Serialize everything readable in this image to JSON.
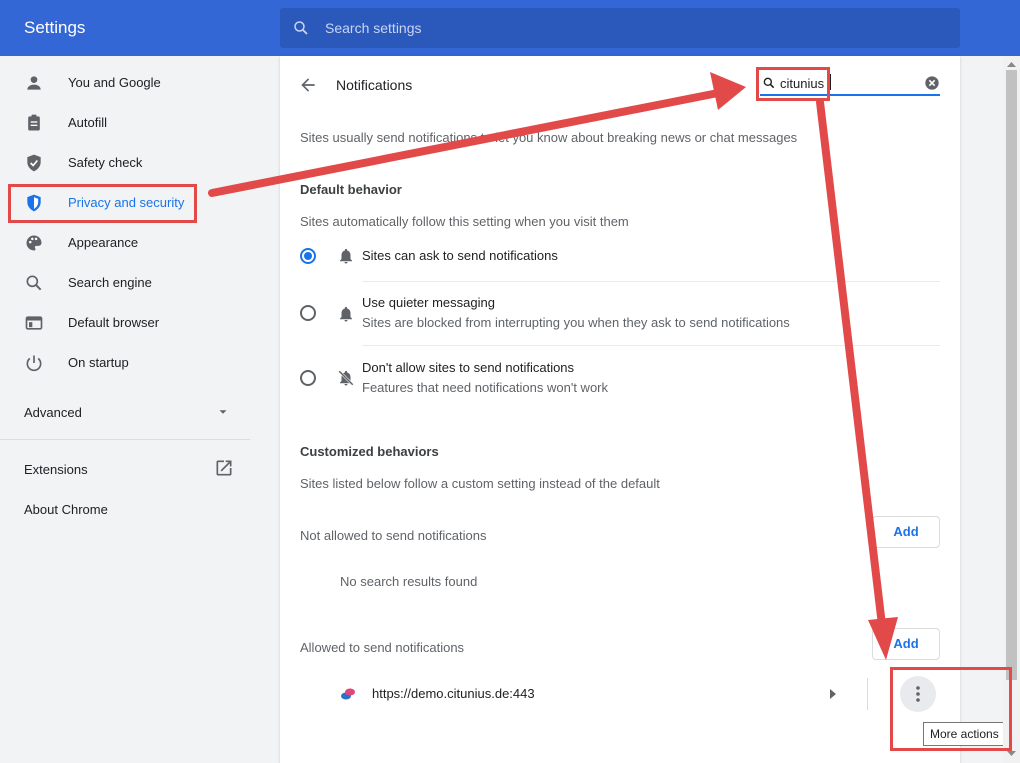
{
  "app_title": "Settings",
  "search": {
    "placeholder": "Search settings"
  },
  "sidebar": {
    "items": [
      {
        "label": "You and Google"
      },
      {
        "label": "Autofill"
      },
      {
        "label": "Safety check"
      },
      {
        "label": "Privacy and security"
      },
      {
        "label": "Appearance"
      },
      {
        "label": "Search engine"
      },
      {
        "label": "Default browser"
      },
      {
        "label": "On startup"
      }
    ],
    "advanced_label": "Advanced",
    "extensions_label": "Extensions",
    "about_label": "About Chrome"
  },
  "page": {
    "title": "Notifications",
    "filter_value": "citunius",
    "description": "Sites usually send notifications to let you know about breaking news or chat messages",
    "default_heading": "Default behavior",
    "default_sub": "Sites automatically follow this setting when you visit them",
    "options": [
      {
        "title": "Sites can ask to send notifications",
        "sub": "",
        "selected": true
      },
      {
        "title": "Use quieter messaging",
        "sub": "Sites are blocked from interrupting you when they ask to send notifications",
        "selected": false
      },
      {
        "title": "Don't allow sites to send notifications",
        "sub": "Features that need notifications won't work",
        "selected": false
      }
    ],
    "custom_heading": "Customized behaviors",
    "custom_sub": "Sites listed below follow a custom setting instead of the default",
    "blocked_label": "Not allowed to send notifications",
    "no_results": "No search results found",
    "allowed_label": "Allowed to send notifications",
    "add_label": "Add",
    "allowed_sites": [
      {
        "url": "https://demo.citunius.de:443"
      }
    ],
    "tooltip": "More actions"
  },
  "colors": {
    "accent": "#1a73e8",
    "header": "#3367d6",
    "annotation": "#e24a4a"
  }
}
